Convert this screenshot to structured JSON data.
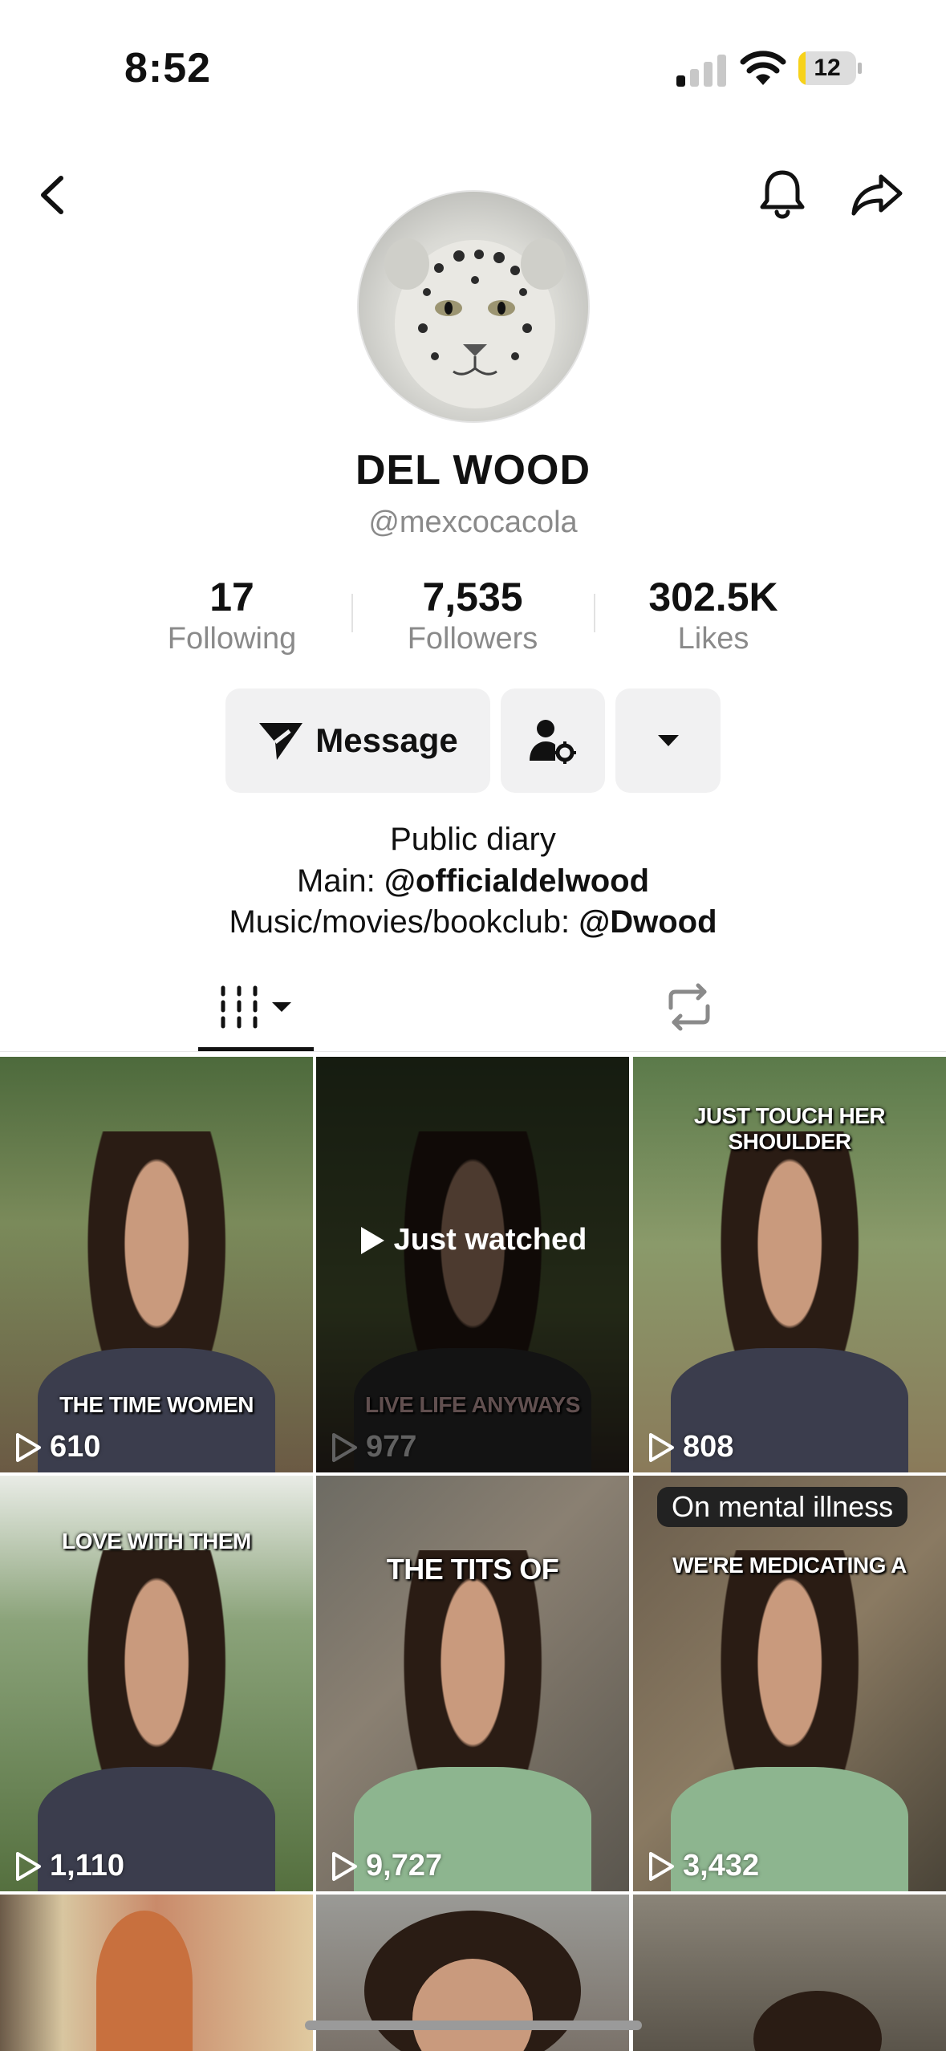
{
  "status_bar": {
    "time": "8:52",
    "battery": "12",
    "battery_level": 0.12,
    "signal_bars_active": 1
  },
  "profile": {
    "name": "DEL WOOD",
    "handle": "@mexcocacola",
    "stats": [
      {
        "value": "17",
        "label": "Following"
      },
      {
        "value": "7,535",
        "label": "Followers"
      },
      {
        "value": "302.5K",
        "label": "Likes"
      }
    ],
    "message_label": "Message",
    "bio": {
      "line1": "Public diary",
      "line2_prefix": "Main: ",
      "line2_link": "@officialdelwood",
      "line3_prefix": "Music/movies/bookclub: ",
      "line3_link": "@Dwood"
    }
  },
  "icons": {
    "back": "chevron-left-icon",
    "bell": "bell-icon",
    "share": "share-arrow-icon",
    "message": "paper-plane-icon",
    "add_friend": "person-gear-icon",
    "more": "caret-down-icon",
    "grid_tab": "grid-icon",
    "repost_tab": "repost-icon",
    "play": "play-icon"
  },
  "videos": [
    {
      "views": "610",
      "caption": "THE TIME WOMEN"
    },
    {
      "views": "977",
      "caption": "LIVE LIFE ANYWAYS",
      "overlay": "Just watched"
    },
    {
      "views": "808",
      "caption": "JUST TOUCH HER SHOULDER"
    },
    {
      "views": "1,110",
      "caption": "LOVE WITH THEM"
    },
    {
      "views": "9,727",
      "caption": "THE TITS OF"
    },
    {
      "views": "3,432",
      "caption": "WE'RE MEDICATING A",
      "pill": "On mental illness"
    }
  ],
  "colors": {
    "accent_text": "#111111",
    "muted": "#8a8a8a",
    "button_bg": "#f1f1f2",
    "battery": "#f7d21b"
  }
}
